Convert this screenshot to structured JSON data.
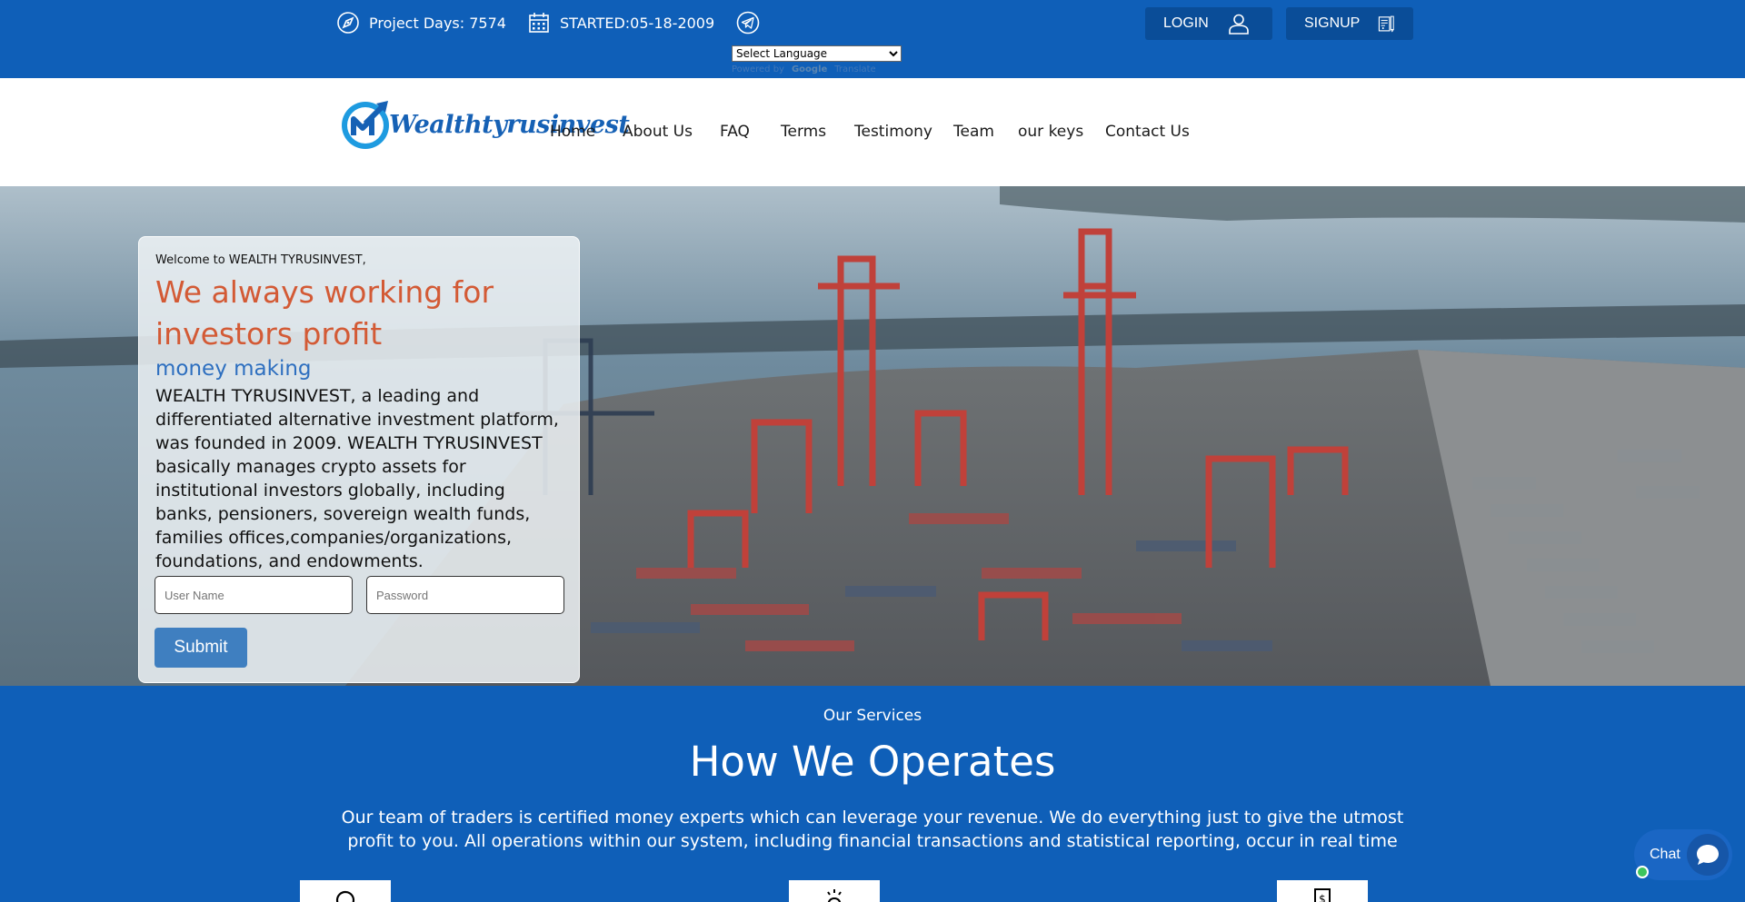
{
  "topbar": {
    "project_days": "Project Days: 7574",
    "started": "STARTED:05-18-2009",
    "language_select": "Select Language",
    "powered_by": "Powered by",
    "google": "Google",
    "translate": "Translate",
    "login_label": "LOGIN",
    "signup_label": "SIGNUP"
  },
  "navbar": {
    "logo_text": "Wealthtyrusinvest",
    "items": [
      {
        "label": "Home"
      },
      {
        "label": "About Us"
      },
      {
        "label": "FAQ"
      },
      {
        "label": "Terms"
      },
      {
        "label": "Testimony"
      },
      {
        "label": "Team"
      },
      {
        "label": "our keys"
      },
      {
        "label": "Contact Us"
      }
    ]
  },
  "hero": {
    "welcome": "Welcome to WEALTH TYRUSINVEST,",
    "headline": "We always working for investors profit",
    "subhead": "money making",
    "description": "WEALTH TYRUSINVEST, a leading and differentiated alternative investment platform, was founded in 2009. WEALTH TYRUSINVEST basically manages crypto assets for institutional investors globally, including banks, pensioners, sovereign wealth funds, families offices,companies/organizations, foundations, and endowments.",
    "username_placeholder": "User Name",
    "password_placeholder": "Password",
    "submit_label": "Submit"
  },
  "services": {
    "eyebrow": "Our Services",
    "title": "How We Operates",
    "text": "Our team of traders is certified money experts which can leverage your revenue. We do everything just to give the utmost profit to you. All operations within our system, including financial transactions and statistical reporting, occur in real time"
  },
  "chat": {
    "label": "Chat"
  },
  "colors": {
    "brand_blue": "#0f5fb8",
    "button_dark_blue": "#0a4d98",
    "headline_orange": "#d35a35",
    "subhead_blue": "#2e6fbf",
    "submit_blue": "#3f7fc0",
    "online_green": "#3cc45c"
  },
  "icons": {
    "project_days": "compass-icon",
    "started": "calendar-icon",
    "telegram": "telegram-icon",
    "login": "user-icon",
    "signup": "signup-form-icon",
    "chat": "chat-bubble-icon"
  }
}
